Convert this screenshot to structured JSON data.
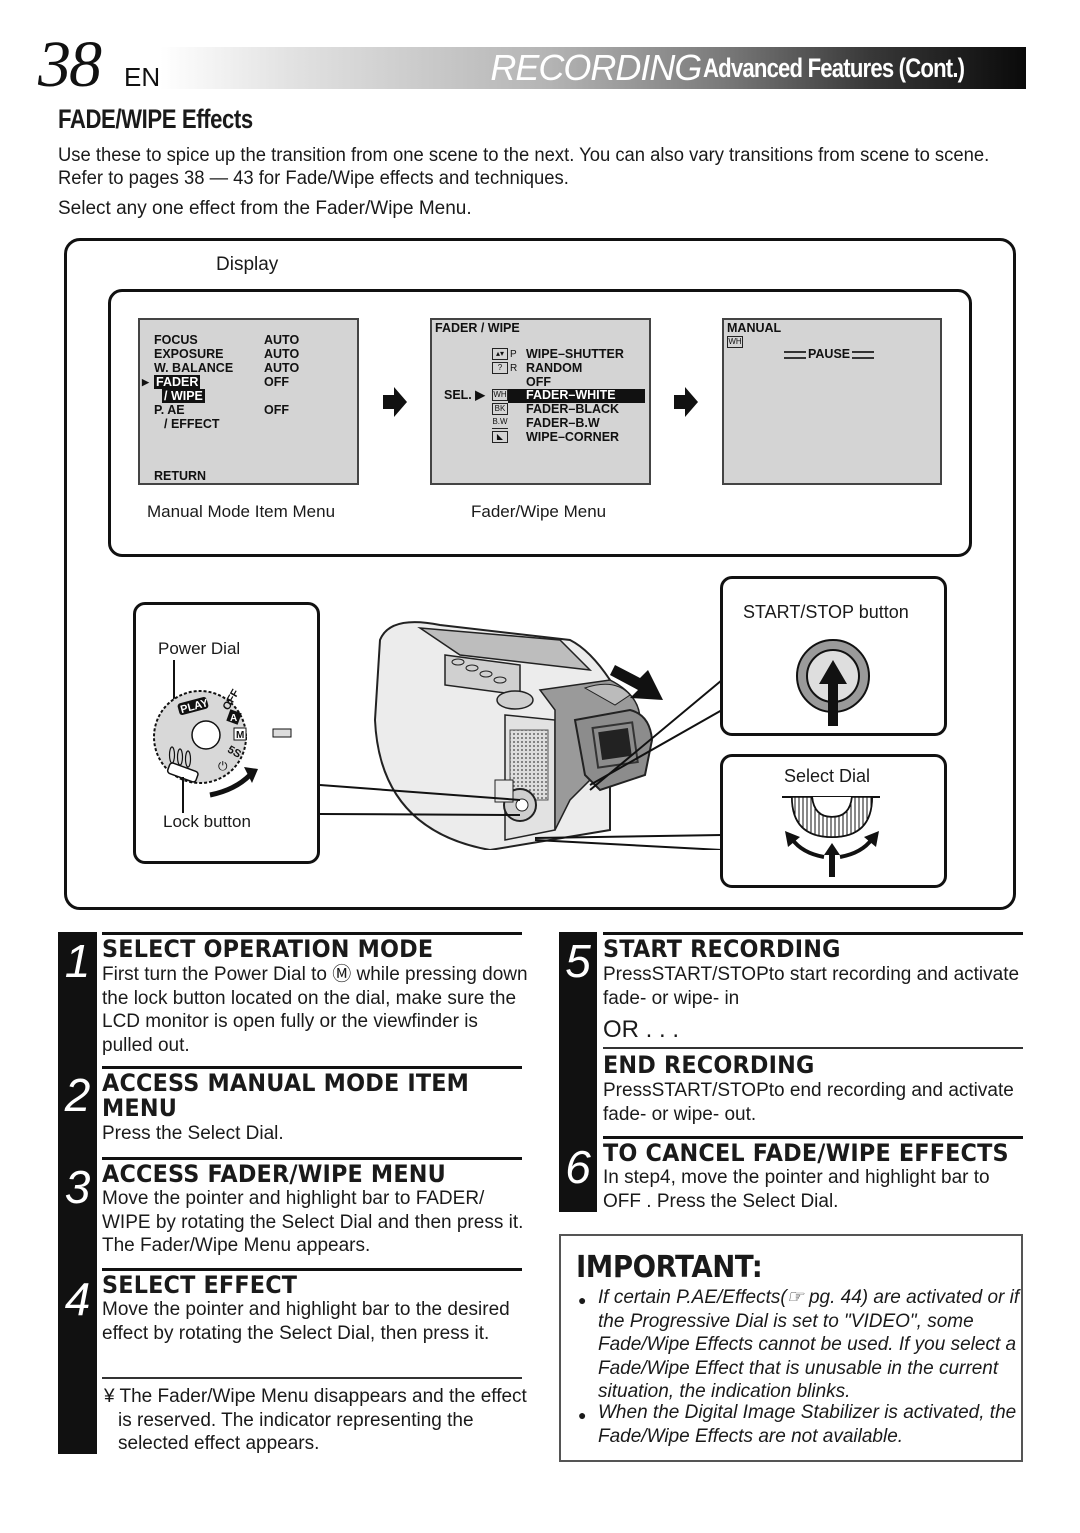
{
  "header": {
    "page_number": "38",
    "language": "EN",
    "title_main": "RECORDING",
    "title_sub": "Advanced Features (Cont.)"
  },
  "section": {
    "title": "FADE/WIPE Effects",
    "intro": "Use these to spice up the transition from one scene to the next. You can also vary transitions from scene to scene. Refer to pages 38 — 43 for Fade/Wipe effects and techniques.",
    "instruction": "Select any one effect from the Fader/Wipe Menu."
  },
  "diagram": {
    "display_label": "Display",
    "manual_menu": {
      "caption": "Manual Mode Item Menu",
      "items": [
        {
          "label": "FOCUS",
          "value": "AUTO"
        },
        {
          "label": "EXPOSURE",
          "value": "AUTO"
        },
        {
          "label": "W. BALANCE",
          "value": "AUTO"
        },
        {
          "label": "FADER",
          "value": "OFF",
          "selected": true
        },
        {
          "label": "/ WIPE",
          "value": "",
          "selected": true
        },
        {
          "label": "P. AE",
          "value": "OFF"
        },
        {
          "label": "/ EFFECT",
          "value": ""
        }
      ],
      "pointer": "▶",
      "return_label": "RETURN"
    },
    "fader_menu": {
      "caption": "Fader/Wipe Menu",
      "title": "FADER / WIPE",
      "sel_label": "SEL. ▶",
      "items": [
        {
          "icon": "▴▾",
          "suffix": "P",
          "label": "WIPE–SHUTTER"
        },
        {
          "icon": "?",
          "suffix": "R",
          "label": "RANDOM"
        },
        {
          "icon": "",
          "suffix": "",
          "label": "OFF"
        },
        {
          "icon": "WH",
          "suffix": "",
          "label": "FADER–WHITE",
          "selected": true
        },
        {
          "icon": "BK",
          "suffix": "",
          "label": "FADER–BLACK"
        },
        {
          "icon": "B.W",
          "suffix": "",
          "label": "FADER–B.W"
        },
        {
          "icon": "◣",
          "suffix": "",
          "label": "WIPE–CORNER"
        }
      ]
    },
    "result_screen": {
      "mode": "MANUAL",
      "indicator": "WH",
      "status": "PAUSE"
    },
    "power_dial": {
      "label": "Power Dial",
      "lock_label": "Lock button",
      "positions": [
        "PLAY",
        "OFF",
        "A",
        "M",
        "5S"
      ]
    },
    "start_stop_label": "START/STOP button",
    "select_dial_label": "Select Dial"
  },
  "steps": [
    {
      "number": "1",
      "title": "SELECT OPERATION MODE",
      "body": "First turn the Power Dial to Ⓜ while pressing down the lock button located on the dial, make sure the LCD monitor is open fully or the viewfinder is pulled out."
    },
    {
      "number": "2",
      "title": "ACCESS MANUAL MODE ITEM MENU",
      "title_line1": "ACCESS MANUAL MODE ITEM",
      "title_line2": "MENU",
      "body": "Press the Select Dial."
    },
    {
      "number": "3",
      "title": "ACCESS FADER/WIPE MENU",
      "body": "Move the pointer and highlight bar to  FADER/ WIPE  by rotating the Select Dial and then press it. The Fader/Wipe Menu appears."
    },
    {
      "number": "4",
      "title": "SELECT EFFECT",
      "body": "Move the pointer and highlight bar to the desired effect by rotating the Select Dial, then press it.",
      "note": "¥ The Fader/Wipe Menu disappears and the effect is reserved. The indicator representing the selected effect appears."
    },
    {
      "number": "5",
      "title": "START RECORDING",
      "body": "PressSTART/STOPto start recording and activate fade- or wipe- in",
      "or_text": "OR . . .",
      "alt_title": "END RECORDING",
      "alt_body": "PressSTART/STOPto end recording and activate fade- or wipe- out."
    },
    {
      "number": "6",
      "title": "TO CANCEL FADE/WIPE EFFECTS",
      "body": "In step4, move the pointer and highlight bar to  OFF . Press the Select Dial."
    }
  ],
  "important": {
    "title": "IMPORTANT:",
    "items": [
      "If certain P.AE/Effects(☞ pg. 44) are activated or if the Progressive Dial is set to \"VIDEO\", some Fade/Wipe Effects cannot be used. If you select a Fade/Wipe Effect that is unusable in the current situation, the indication blinks.",
      "When the Digital Image Stabilizer is activated, the Fade/Wipe Effects are not available."
    ],
    "bullet": "●"
  }
}
